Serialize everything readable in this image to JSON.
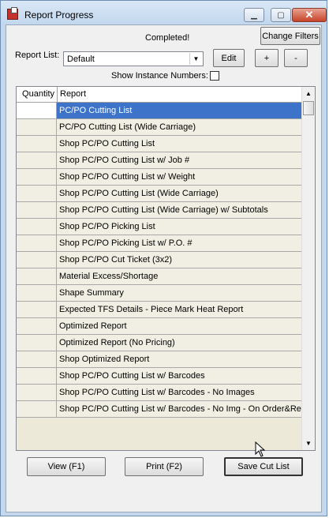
{
  "window": {
    "title": "Report Progress"
  },
  "status": "Completed!",
  "buttons": {
    "change_filters": "Change Filters",
    "edit": "Edit",
    "add": "+",
    "remove": "-",
    "view": "View (F1)",
    "print": "Print (F2)",
    "save": "Save Cut List"
  },
  "report_list": {
    "label": "Report List:",
    "value": "Default"
  },
  "instance": {
    "label": "Show Instance Numbers:"
  },
  "table": {
    "columns": [
      "Quantity",
      "Report"
    ],
    "rows": [
      {
        "quantity": "",
        "report": "PC/PO Cutting List"
      },
      {
        "quantity": "",
        "report": "PC/PO Cutting List (Wide Carriage)"
      },
      {
        "quantity": "",
        "report": "Shop PC/PO Cutting List"
      },
      {
        "quantity": "",
        "report": "Shop PC/PO Cutting List w/ Job #"
      },
      {
        "quantity": "",
        "report": "Shop PC/PO Cutting List w/ Weight"
      },
      {
        "quantity": "",
        "report": "Shop PC/PO Cutting List (Wide Carriage)"
      },
      {
        "quantity": "",
        "report": "Shop PC/PO Cutting List (Wide Carriage) w/ Subtotals"
      },
      {
        "quantity": "",
        "report": "Shop PC/PO Picking List"
      },
      {
        "quantity": "",
        "report": "Shop PC/PO Picking List w/ P.O. #"
      },
      {
        "quantity": "",
        "report": "Shop PC/PO Cut Ticket (3x2)"
      },
      {
        "quantity": "",
        "report": "Material Excess/Shortage"
      },
      {
        "quantity": "",
        "report": "Shape Summary"
      },
      {
        "quantity": "",
        "report": "Expected TFS Details - Piece Mark Heat Report"
      },
      {
        "quantity": "",
        "report": "Optimized Report"
      },
      {
        "quantity": "",
        "report": "Optimized Report (No Pricing)"
      },
      {
        "quantity": "",
        "report": "Shop Optimized Report"
      },
      {
        "quantity": "",
        "report": "Shop PC/PO Cutting List w/ Barcodes"
      },
      {
        "quantity": "",
        "report": "Shop PC/PO Cutting List w/ Barcodes - No Images"
      },
      {
        "quantity": "",
        "report": "Shop PC/PO Cutting List w/ Barcodes - No Img - On Order&Req"
      }
    ]
  },
  "colors": {
    "selection": "#3d74c9",
    "row_bg": "#f1efe3",
    "frame": "#c4d7ed"
  }
}
